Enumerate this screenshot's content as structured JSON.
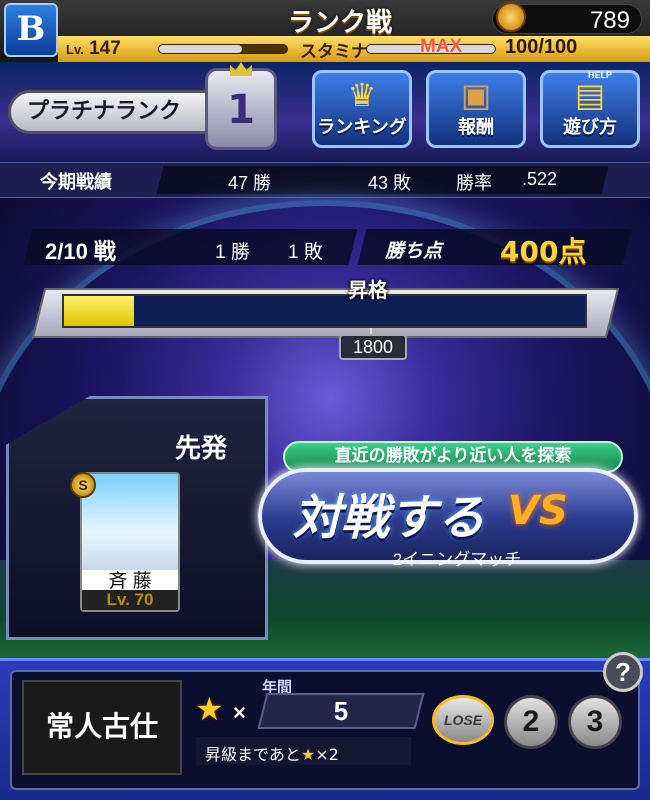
{
  "header": {
    "logo_icon": "team-b-logo-icon",
    "title": "ランク戦",
    "coins": "789"
  },
  "status": {
    "lv_prefix": "Lv.",
    "level": "147",
    "stamina_label": "スタミナ",
    "stamina_max_label": "MAX",
    "stamina_value": "100/100",
    "exp_fill": 0.65,
    "stamina_fill": 1.0
  },
  "rank": {
    "label": "プラチナランク",
    "number": "1"
  },
  "menu": [
    {
      "label": "ランキング",
      "icon": "crown-icon"
    },
    {
      "label": "報酬",
      "icon": "treasure-chest-icon"
    },
    {
      "label": "遊び方",
      "icon": "help-book-icon",
      "badge": "HELP"
    }
  ],
  "record": {
    "label": "今期戦績",
    "wins": "47 勝",
    "losses": "43 敗",
    "rate_label": "勝率",
    "rate": ".522"
  },
  "series": {
    "progress": "2/10 戦",
    "wins": "1 勝",
    "losses": "1 敗",
    "points_label": "勝ち点",
    "points": "400点"
  },
  "promotion": {
    "label": "昇格",
    "threshold": "1800",
    "fill": 0.135
  },
  "starter": {
    "label": "先発",
    "rank": "S",
    "player_name": "斉 藤",
    "player_lv": "Lv. 70"
  },
  "battle": {
    "banner": "直近の勝敗がより近い人を探索",
    "button": "対戦する",
    "vs": "VS",
    "match_type": "2イニングマッチ"
  },
  "bottom": {
    "motto": "常人古仕",
    "stars_label": "×",
    "year_label": "年間",
    "year_value": "5",
    "need_text_pre": "昇級まであと",
    "need_text_post": "×2",
    "lose_label": "LOSE",
    "lose_counts": [
      "2",
      "3"
    ],
    "help": "?"
  }
}
